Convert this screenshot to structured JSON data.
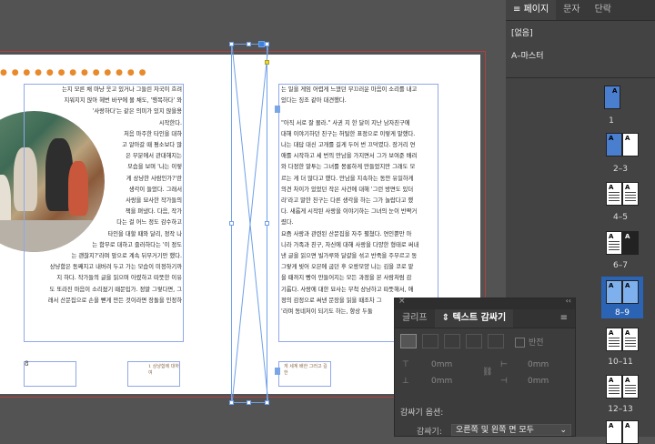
{
  "pages_panel": {
    "tabs": [
      "페이지",
      "문자",
      "단락"
    ],
    "none_label": "[없음]",
    "master_label": "A–마스터",
    "page_labels": [
      "1",
      "2–3",
      "4–5",
      "6–7",
      "8–9",
      "10–11",
      "12–13"
    ],
    "selected_spread": "8–9"
  },
  "text_wrap_panel": {
    "tabs": [
      "글리프",
      "텍스트 감싸기"
    ],
    "invert_label": "반전",
    "offset_top": "0mm",
    "offset_bottom": "0mm",
    "offset_left": "0mm",
    "offset_right": "0mm",
    "wrap_options_label": "감싸기 옵션:",
    "wrap_to_label": "감싸기:",
    "wrap_to_value": "오른쪽 및 왼쪽 면 모두"
  },
  "document": {
    "left_text": "는지 모른 채 마냥 웃고 있거나 그들린 자국이 흐려\n지워지지 않아 헤번 바꾸에 몰 채도, '행복하다' 와\n'사랑하다'는 같은 의미가 있지 않을용\n시작한다.\n처음 마주한 타인을 대하\n고 알아갈 때 평소보다 많\n은 부분에서 관대해지는\n모습을 보며 '나는 이렇\n게 상냥한 사람인가?'란\n생각이 들었다. 그래서\n사랑을 묘사한 작가들의\n책을 펴냈다. 다음, 작가\n다는 걸 어느 정도 감수하고\n타인을 대할 때와 달리, 정작 나\n는 함부로 대하고 즐러하다는 '이 정도\n는 괜찮지?'라며 앞으로 계속 뒤부거기만 했다.\n상냥함은 동째지고 내버려 두고 가는 모습이 미정하기까\n지 하다. 작가들의 글을 읽으며 아렸하고 따뜻한 이유\n도 또라진 마음이 소리졌기 때문입가. 정말 그렇다면, 그\n래서 산문집으로 손을 뻗게 만든 것이라면 장돌을 인정하",
    "right_text": "는 일을 게임 어렵게 느꼈던 부끄러운 마음이 소리를 내고\n있다는 징조 같아 대견했다.\n\n\"아직 서로 잘 몰라.\" 사귄 지 한 달이 지난 남자친구에\n대해 이야기하던 친구는 허탈한 표정으로 이렇게 말했다.\n나는 대답 대신 고개를 길게 두어 번 끄덕였다. 장거리 연\n애를 시작하고 세 번의 만남을 가지면서 그가 보여준 배려\n와 다정한 말투는 그녀를 몽롱하게 만들었지만 그래도 모\n르는 게 더 많다고 했다. 만남을 지속하는 동안 유일하게\n의견 차이가 있었던 작은 사건에 대해 '그런 방면도 있더\n라'라고 말한 친구는 다른 생각을 하는 그가 놀랍다고 했\n다. 새롭게 시작된 사랑을 이야기하는 그녀의 눈이 반짝거\n렸다.\n요즘 사랑과 관련된 산문집을 자주 펼쳤다. 연인뿐만 아\n니라 가족과 친구, 자신에 대해 사랑을 다양한 형태로 써내\n낸 글을 읽으면 빌가루와 달걀을 섞고 반죽을 주무르고 동\n그랗게 빚어 오븐에 굽던 후 오랑모양 나는 김을 코로 맡\n을 때까지 빵이 만들어지는 모든 과정을 본 사람처럼 감\n기롭다. 사랑에 대한 묘사는 무척 상냥하고 따뜻해서, 애\n정의 감정으로 써낸 문장을 읽을 때조차 그\n'라며 동네처이 되기도 하는, 항상 두둘",
    "left_footer_caption": "1 상냥함에 대하여",
    "right_footer_caption": "게 세계 배한 그러고 길 한",
    "folio_left": "8"
  }
}
